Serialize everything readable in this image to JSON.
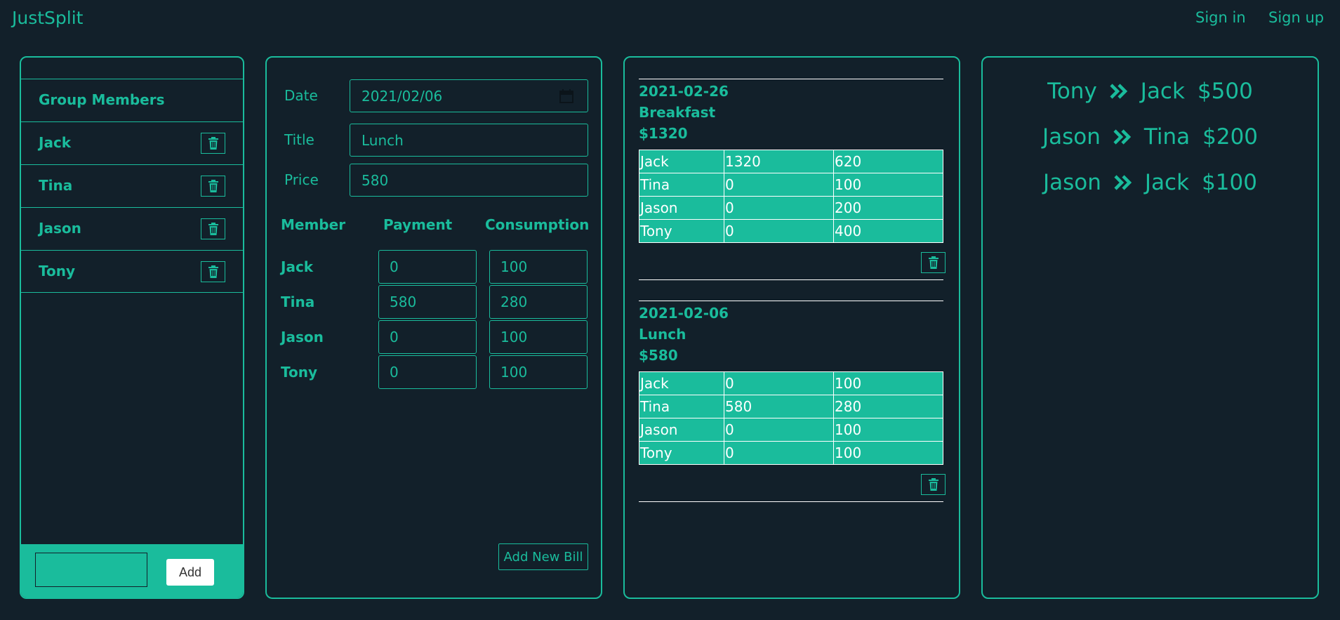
{
  "navbar": {
    "brand": "JustSplit",
    "sign_in": "Sign in",
    "sign_up": "Sign up"
  },
  "members_panel": {
    "header": "Group Members",
    "members": [
      "Jack",
      "Tina",
      "Jason",
      "Tony"
    ],
    "add_input_value": "",
    "add_button": "Add"
  },
  "bill_form": {
    "date_label": "Date",
    "date_value": "2021/02/06",
    "title_label": "Title",
    "title_value": "Lunch",
    "price_label": "Price",
    "price_value": "580",
    "col_member": "Member",
    "col_payment": "Payment",
    "col_consumption": "Consumption",
    "rows": [
      {
        "member": "Jack",
        "payment": "0",
        "consumption": "100"
      },
      {
        "member": "Tina",
        "payment": "580",
        "consumption": "280"
      },
      {
        "member": "Jason",
        "payment": "0",
        "consumption": "100"
      },
      {
        "member": "Tony",
        "payment": "0",
        "consumption": "100"
      }
    ],
    "add_bill_button": "Add New Bill"
  },
  "bills": [
    {
      "date": "2021-02-26",
      "title": "Breakfast",
      "price": "$1320",
      "rows": [
        [
          "Jack",
          "1320",
          "620"
        ],
        [
          "Tina",
          "0",
          "100"
        ],
        [
          "Jason",
          "0",
          "200"
        ],
        [
          "Tony",
          "0",
          "400"
        ]
      ]
    },
    {
      "date": "2021-02-06",
      "title": "Lunch",
      "price": "$580",
      "rows": [
        [
          "Jack",
          "0",
          "100"
        ],
        [
          "Tina",
          "580",
          "280"
        ],
        [
          "Jason",
          "0",
          "100"
        ],
        [
          "Tony",
          "0",
          "100"
        ]
      ]
    }
  ],
  "settlements": [
    {
      "from": "Tony",
      "to": "Jack",
      "amount": "$500"
    },
    {
      "from": "Jason",
      "to": "Tina",
      "amount": "$200"
    },
    {
      "from": "Jason",
      "to": "Jack",
      "amount": "$100"
    }
  ],
  "icons": {
    "trash": "trash-icon",
    "calendar": "calendar-icon",
    "arrow": "double-chevron-right-icon"
  },
  "colors": {
    "background": "#12202a",
    "accent": "#1abc9c",
    "table_text": "#ffffff"
  }
}
